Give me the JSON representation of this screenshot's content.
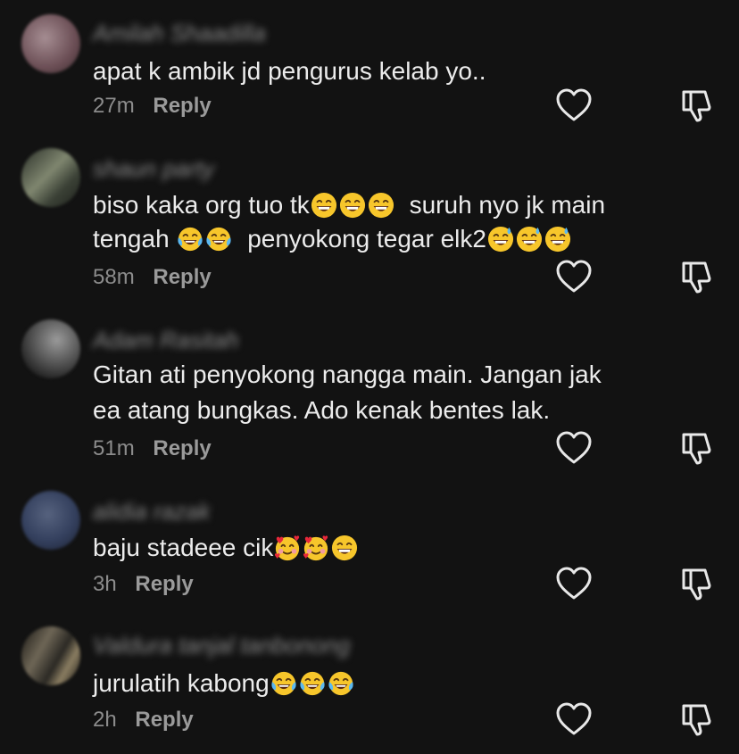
{
  "comments": [
    {
      "username": "Amilah Shaadilla",
      "text_lines": [
        "apat k ambik jd pengurus kelab yo.."
      ],
      "time": "27m",
      "reply_label": "Reply",
      "avatar_color": "#6b4e55"
    },
    {
      "username": "shaun party",
      "text_lines": [
        "biso kaka org tuo tk",
        "suruh nyo jk main",
        "tengah",
        "penyokong tegar elk2"
      ],
      "time": "58m",
      "reply_label": "Reply",
      "avatar_color": "#4a5244"
    },
    {
      "username": "Adam Rasitah",
      "text_lines": [
        "Gitan ati penyokong nangga main. Jangan jak",
        "ea atang bungkas. Ado kenak bentes lak."
      ],
      "time": "51m",
      "reply_label": "Reply",
      "avatar_color": "#444444"
    },
    {
      "username": "alidia razak",
      "text_lines": [
        "baju stadeee cik"
      ],
      "time": "3h",
      "reply_label": "Reply",
      "avatar_color": "#34405e"
    },
    {
      "username": "Valdura tanjal tanbonong",
      "text_lines": [
        "jurulatih kabong"
      ],
      "time": "2h",
      "reply_label": "Reply",
      "avatar_color": "#3d3a34"
    }
  ],
  "icons": {
    "like": "heart-outline-icon",
    "dislike": "thumbs-down-outline-icon",
    "emoji_grin": "grinning-squinting-face-emoji",
    "emoji_joy": "face-with-tears-of-joy-emoji",
    "emoji_sweat": "grinning-face-with-sweat-emoji",
    "emoji_hearts": "smiling-face-with-hearts-emoji"
  },
  "colors": {
    "background": "#121212",
    "text": "#ececec",
    "meta": "#8c8c8c",
    "emoji_yellow": "#f7c62b"
  }
}
